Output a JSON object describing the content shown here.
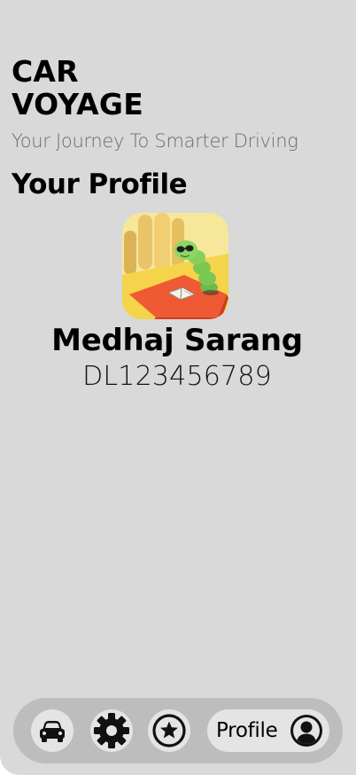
{
  "app": {
    "title_line1": "CAR",
    "title_line2": "VOYAGE",
    "tagline": "Your Journey To Smarter Driving"
  },
  "profile": {
    "section_title": "Your Profile",
    "name": "Medhaj Sarang",
    "license_number": "DL123456789",
    "avatar_icon": "caterpillar-reading-avatar"
  },
  "bottom_nav": {
    "items": [
      {
        "icon": "car-icon",
        "active": false
      },
      {
        "icon": "gear-icon",
        "active": false
      },
      {
        "icon": "star-icon",
        "active": false
      },
      {
        "icon": "user-icon",
        "label": "Profile",
        "active": true
      }
    ]
  },
  "colors": {
    "background": "#d9d9d9",
    "nav_bar": "#bdbdbd",
    "nav_button": "#e4e4e4",
    "text_primary": "#000000",
    "text_muted": "#6b6b6b"
  }
}
